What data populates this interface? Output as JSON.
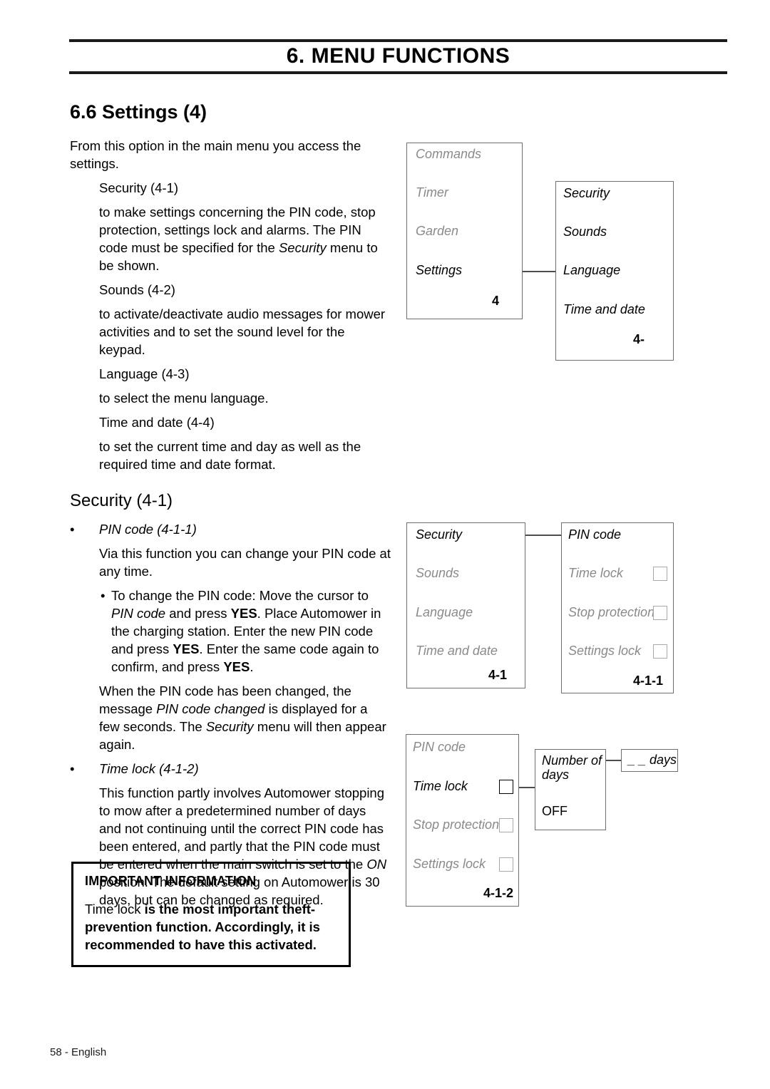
{
  "header": {
    "chapter_title": "6. MENU FUNCTIONS"
  },
  "section": {
    "heading": "6.6 Settings (4)"
  },
  "body": {
    "intro": "From this option in the main menu you access the settings.",
    "items": [
      {
        "title": "Security (4-1)",
        "desc_parts": [
          {
            "text": "to make settings concerning the PIN code, stop protection, settings lock and alarms. The PIN code must be specified for the ",
            "style": "normal"
          },
          {
            "text": "Security",
            "style": "italic"
          },
          {
            "text": " menu to be shown.",
            "style": "normal"
          }
        ]
      },
      {
        "title": "Sounds (4-2)",
        "desc": "to activate/deactivate audio messages for mower activities and to set the sound level for the keypad."
      },
      {
        "title": "Language (4-3)",
        "desc": "to select the menu language."
      },
      {
        "title": "Time and date (4-4)",
        "desc": "to set the current time and day as well as the required time and date format."
      }
    ],
    "security_heading": "Security (4-1)",
    "bullet_marker": "•",
    "pin_code_bullet": "PIN code (4-1-1)",
    "pin_code_intro": "Via this function you can change your PIN code at any time.",
    "pin_code_steps": [
      {
        "text": "To change the PIN code: Move the cursor to ",
        "style": "normal"
      },
      {
        "text": "PIN code",
        "style": "italic"
      },
      {
        "text": " and press ",
        "style": "normal"
      },
      {
        "text": "YES",
        "style": "bold"
      },
      {
        "text": ". Place Automower in the charging station. Enter the new PIN code and press ",
        "style": "normal"
      },
      {
        "text": "YES",
        "style": "bold"
      },
      {
        "text": ". Enter the same code again to confirm, and press ",
        "style": "normal"
      },
      {
        "text": "YES",
        "style": "bold"
      },
      {
        "text": ".",
        "style": "normal"
      }
    ],
    "pin_code_changed": [
      {
        "text": "When the PIN code has been changed, the message ",
        "style": "normal"
      },
      {
        "text": "PIN code changed",
        "style": "italic"
      },
      {
        "text": " is displayed for a few seconds. The ",
        "style": "normal"
      },
      {
        "text": "Security",
        "style": "italic"
      },
      {
        "text": " menu will then appear again.",
        "style": "normal"
      }
    ],
    "time_lock_bullet": "Time lock (4-1-2)",
    "time_lock_desc": [
      {
        "text": "This function partly involves Automower stopping to mow after a predetermined number of days and not continuing until the correct PIN code has been entered, and partly that the PIN code must be entered when the main switch is set to the ",
        "style": "normal"
      },
      {
        "text": "ON",
        "style": "italic"
      },
      {
        "text": " position. The default setting on Automower is 30 days, but can be changed as required.",
        "style": "normal"
      }
    ]
  },
  "info_box": {
    "title": "IMPORTANT INFORMATION",
    "lead": "Time lock ",
    "rest": " is the most important theft-prevention function. Accordingly, it is recommended to have this activated."
  },
  "diagrams": {
    "d1": {
      "box_a": {
        "items": [
          {
            "label": "Commands",
            "state": "dim"
          },
          {
            "label": "Timer",
            "state": "dim"
          },
          {
            "label": "Garden",
            "state": "dim"
          },
          {
            "label": "Settings",
            "state": "active"
          }
        ],
        "code": "4"
      },
      "box_b": {
        "items": [
          {
            "label": "Security",
            "state": "active"
          },
          {
            "label": "Sounds",
            "state": "active"
          },
          {
            "label": "Language",
            "state": "active"
          },
          {
            "label": "Time and date",
            "state": "active"
          }
        ],
        "code": "4-"
      }
    },
    "d2": {
      "box_a": {
        "items": [
          {
            "label": "Security",
            "state": "active"
          },
          {
            "label": "Sounds",
            "state": "dim"
          },
          {
            "label": "Language",
            "state": "dim"
          },
          {
            "label": "Time and date",
            "state": "dim"
          }
        ],
        "code": "4-1"
      },
      "box_b": {
        "items": [
          {
            "label": "PIN code",
            "state": "active",
            "checkbox": false
          },
          {
            "label": "Time lock",
            "state": "dim",
            "checkbox": true
          },
          {
            "label": "Stop protection",
            "state": "dim",
            "checkbox": true
          },
          {
            "label": "Settings lock",
            "state": "dim",
            "checkbox": true
          }
        ],
        "code": "4-1-1"
      }
    },
    "d3": {
      "box_a": {
        "items": [
          {
            "label": "PIN code",
            "state": "dim",
            "checkbox": false
          },
          {
            "label": "Time lock",
            "state": "active",
            "checkbox": true
          },
          {
            "label": "Stop protection",
            "state": "dim",
            "checkbox": true
          },
          {
            "label": "Settings lock",
            "state": "dim",
            "checkbox": true
          }
        ],
        "code": "4-1-2"
      },
      "box_b": {
        "line1": "Number of",
        "line2": "days",
        "line3": "OFF"
      },
      "box_c": {
        "label": "_ _ days"
      }
    }
  },
  "footer": {
    "text": "58 - English"
  }
}
